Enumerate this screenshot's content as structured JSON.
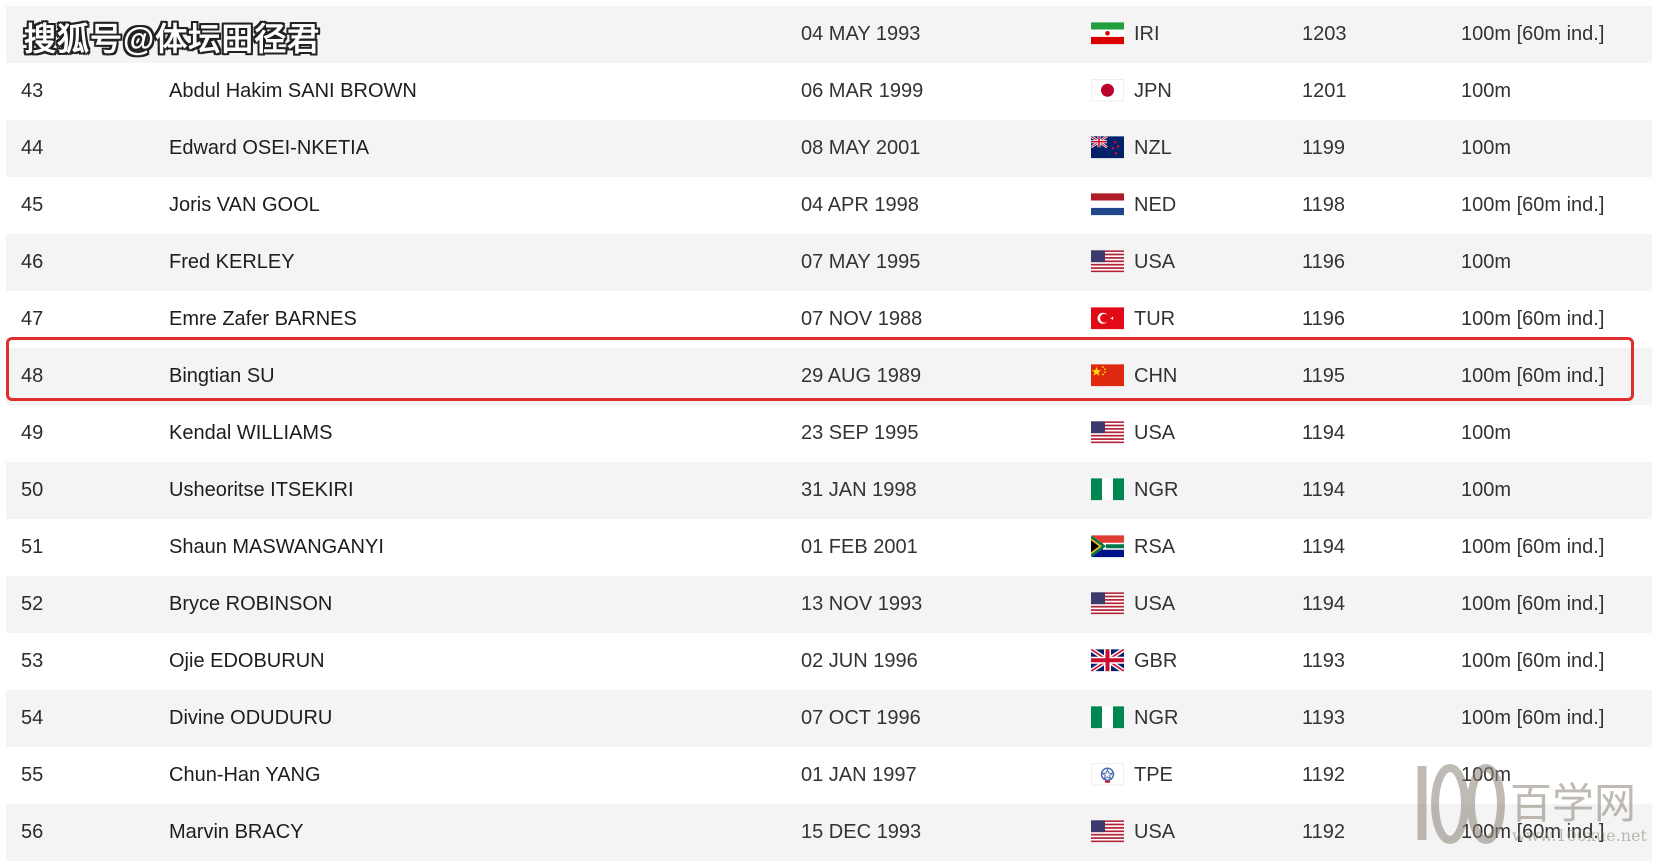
{
  "watermark_top": "搜狐号@体坛田径君",
  "watermark_bottom": {
    "text": "百学网",
    "url": "www.100xue.net"
  },
  "colors": {
    "row_alt": "#f4f4f4",
    "highlight": "#e02e2e"
  },
  "table": {
    "rows": [
      {
        "rank": "",
        "name": "",
        "dob": "04 MAY 1993",
        "flag": "flag-iri-icon",
        "nat": "IRI",
        "score": "1203",
        "event": "100m [60m ind.]"
      },
      {
        "rank": "43",
        "name": "Abdul Hakim SANI BROWN",
        "dob": "06 MAR 1999",
        "flag": "flag-jpn-icon",
        "nat": "JPN",
        "score": "1201",
        "event": "100m"
      },
      {
        "rank": "44",
        "name": "Edward OSEI-NKETIA",
        "dob": "08 MAY 2001",
        "flag": "flag-nzl-icon",
        "nat": "NZL",
        "score": "1199",
        "event": "100m"
      },
      {
        "rank": "45",
        "name": "Joris VAN GOOL",
        "dob": "04 APR 1998",
        "flag": "flag-ned-icon",
        "nat": "NED",
        "score": "1198",
        "event": "100m [60m ind.]"
      },
      {
        "rank": "46",
        "name": "Fred KERLEY",
        "dob": "07 MAY 1995",
        "flag": "flag-usa-icon",
        "nat": "USA",
        "score": "1196",
        "event": "100m"
      },
      {
        "rank": "47",
        "name": "Emre Zafer BARNES",
        "dob": "07 NOV 1988",
        "flag": "flag-tur-icon",
        "nat": "TUR",
        "score": "1196",
        "event": "100m [60m ind.]"
      },
      {
        "rank": "48",
        "name": "Bingtian SU",
        "dob": "29 AUG 1989",
        "flag": "flag-chn-icon",
        "nat": "CHN",
        "score": "1195",
        "event": "100m [60m ind.]"
      },
      {
        "rank": "49",
        "name": "Kendal WILLIAMS",
        "dob": "23 SEP 1995",
        "flag": "flag-usa-icon",
        "nat": "USA",
        "score": "1194",
        "event": "100m"
      },
      {
        "rank": "50",
        "name": "Usheoritse ITSEKIRI",
        "dob": "31 JAN 1998",
        "flag": "flag-ngr-icon",
        "nat": "NGR",
        "score": "1194",
        "event": "100m"
      },
      {
        "rank": "51",
        "name": "Shaun MASWANGANYI",
        "dob": "01 FEB 2001",
        "flag": "flag-rsa-icon",
        "nat": "RSA",
        "score": "1194",
        "event": "100m [60m ind.]"
      },
      {
        "rank": "52",
        "name": "Bryce ROBINSON",
        "dob": "13 NOV 1993",
        "flag": "flag-usa-icon",
        "nat": "USA",
        "score": "1194",
        "event": "100m [60m ind.]"
      },
      {
        "rank": "53",
        "name": "Ojie EDOBURUN",
        "dob": "02 JUN 1996",
        "flag": "flag-gbr-icon",
        "nat": "GBR",
        "score": "1193",
        "event": "100m [60m ind.]"
      },
      {
        "rank": "54",
        "name": "Divine ODUDURU",
        "dob": "07 OCT 1996",
        "flag": "flag-ngr-icon",
        "nat": "NGR",
        "score": "1193",
        "event": "100m [60m ind.]"
      },
      {
        "rank": "55",
        "name": "Chun-Han YANG",
        "dob": "01 JAN 1997",
        "flag": "flag-tpe-icon",
        "nat": "TPE",
        "score": "1192",
        "event": "100m"
      },
      {
        "rank": "56",
        "name": "Marvin BRACY",
        "dob": "15 DEC 1993",
        "flag": "flag-usa-icon",
        "nat": "USA",
        "score": "1192",
        "event": "100m [60m ind.]"
      }
    ]
  }
}
